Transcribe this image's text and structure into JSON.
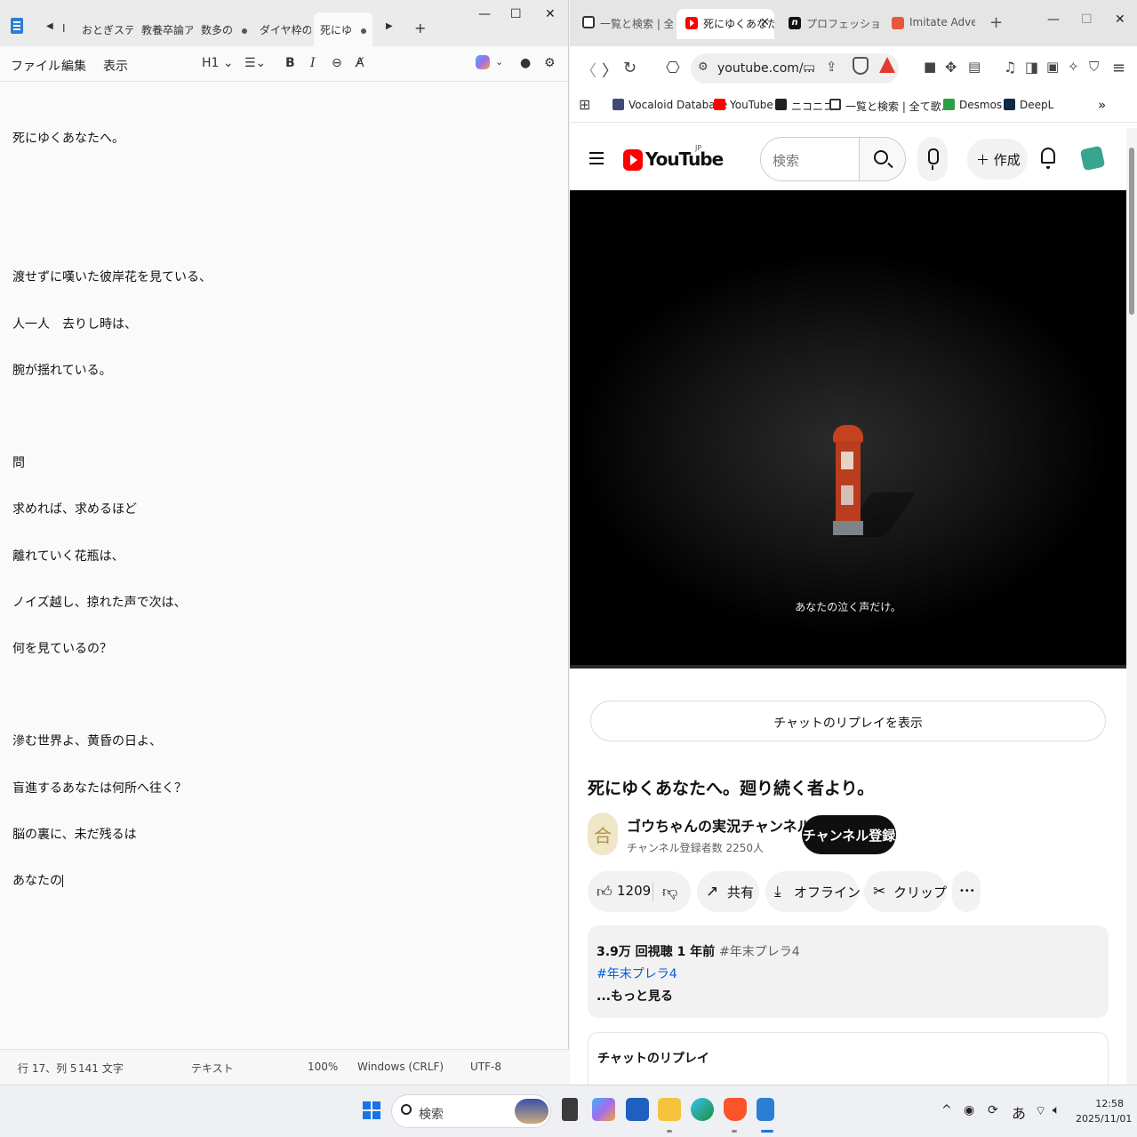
{
  "notepad": {
    "tabs": [
      {
        "label": "I",
        "dirty": false
      },
      {
        "label": "おとぎステップ",
        "dirty": false
      },
      {
        "label": "教養卒論アウ",
        "dirty": false
      },
      {
        "label": "数多の",
        "dirty": true
      },
      {
        "label": "ダイヤ枠のBPM",
        "dirty": false
      },
      {
        "label": "死にゆ",
        "dirty": true,
        "active": true
      }
    ],
    "menu": {
      "file": "ファイル",
      "edit": "編集",
      "view": "表示"
    },
    "toolbar": {
      "heading": "H1",
      "bold": "B",
      "italic": "I"
    },
    "lines": [
      "死にゆくあなたへ。",
      "",
      "",
      "渡せずに嘆いた彼岸花を見ている、",
      "人一人　去りし時は、",
      "腕が揺れている。",
      "",
      "問",
      "求めれば、求めるほど",
      "離れていく花瓶は、",
      "ノイズ越し、掠れた声で次は、",
      "何を見ているの？",
      "",
      "滲む世界よ、黄昏の日よ、",
      "盲進するあなたは何所へ往く？",
      "脳の裏に、未だ残るは",
      "あなたの"
    ],
    "status": {
      "position": "行 17、列 5",
      "chars": "141 文字",
      "format": "テキスト",
      "zoom": "100%",
      "line_ending": "Windows (CRLF)",
      "encoding": "UTF-8"
    }
  },
  "browser": {
    "tabs": [
      {
        "label": "一覧と検索 | 全て",
        "favicon": "book-icon"
      },
      {
        "label": "死にゆくあなた",
        "favicon": "youtube-icon",
        "active": true
      },
      {
        "label": "プロフェッショナル オ",
        "favicon": "note-icon"
      },
      {
        "label": "Imitate Advent C",
        "favicon": "imitate-icon"
      }
    ],
    "url": "youtube.com/...",
    "bookmarks": [
      {
        "label": "Vocaloid Database"
      },
      {
        "label": "YouTube"
      },
      {
        "label": "ニコニコ"
      },
      {
        "label": "一覧と検索 | 全て歌..."
      },
      {
        "label": "Desmos"
      },
      {
        "label": "DeepL"
      }
    ],
    "more_bookmarks": "»",
    "accent_color": "#ff0000"
  },
  "youtube": {
    "logo_text": "YouTube",
    "region": "JP",
    "search_placeholder": "検索",
    "create_label": "作成",
    "video_subtitle": "あなたの泣く声だけ。",
    "chat_replay_button": "チャットのリプレイを表示",
    "title": "死にゆくあなたへ。廻り続く者より。",
    "channel": {
      "avatar_glyph": "合",
      "name": "ゴウちゃんの実況チャンネル!",
      "subscribers": "チャンネル登録者数 2250人",
      "subscribe_label": "チャンネル登録"
    },
    "actions": {
      "likes": "1209",
      "share": "共有",
      "offline": "オフライン",
      "clip": "クリップ",
      "more": "•••"
    },
    "description": {
      "stats": "3.9万 回視聴  1 年前",
      "stats_tag": "#年末プレラ4",
      "hashtag": "#年末プレラ4",
      "more": "...もっと見る"
    },
    "chat_panel_title": "チャットのリプレイ"
  },
  "taskbar": {
    "search_label": "検索",
    "ime": "あ",
    "time": "12:58",
    "date": "2025/11/01"
  }
}
